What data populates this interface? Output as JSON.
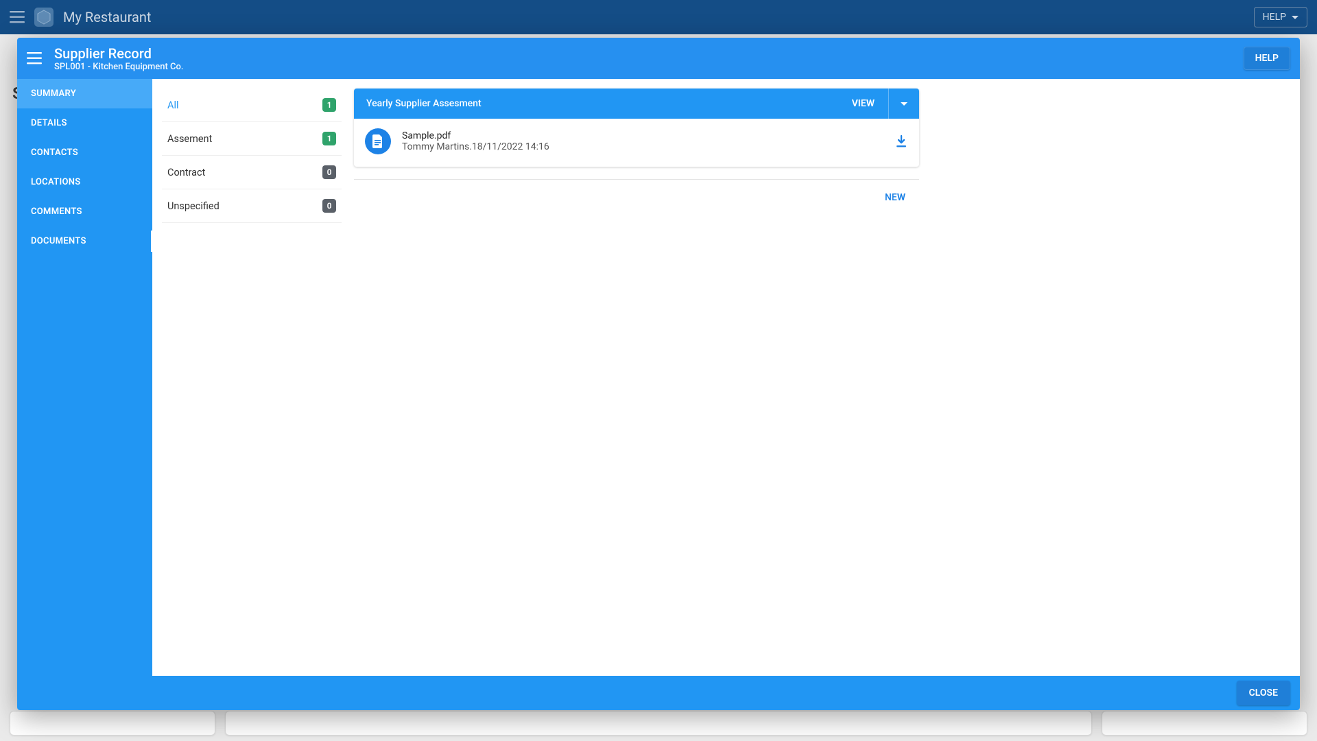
{
  "app_bar": {
    "title": "My Restaurant",
    "help_label": "HELP"
  },
  "background": {
    "page_initial": "S"
  },
  "modal": {
    "title": "Supplier Record",
    "subtitle": "SPL001 - Kitchen Equipment Co.",
    "help_label": "HELP",
    "close_label": "CLOSE"
  },
  "sidebar": {
    "items": [
      {
        "label": "SUMMARY"
      },
      {
        "label": "DETAILS"
      },
      {
        "label": "CONTACTS"
      },
      {
        "label": "LOCATIONS"
      },
      {
        "label": "COMMENTS"
      },
      {
        "label": "DOCUMENTS"
      }
    ]
  },
  "filters": [
    {
      "label": "All",
      "count": "1",
      "color": "green",
      "active": true
    },
    {
      "label": "Assement",
      "count": "1",
      "color": "green",
      "active": false
    },
    {
      "label": "Contract",
      "count": "0",
      "color": "grey",
      "active": false
    },
    {
      "label": "Unspecified",
      "count": "0",
      "color": "grey",
      "active": false
    }
  ],
  "document_card": {
    "title": "Yearly Supplier Assesment",
    "view_label": "VIEW",
    "file": {
      "name": "Sample.pdf",
      "meta": "Tommy Martins.18/11/2022 14:16"
    }
  },
  "new_label": "NEW"
}
